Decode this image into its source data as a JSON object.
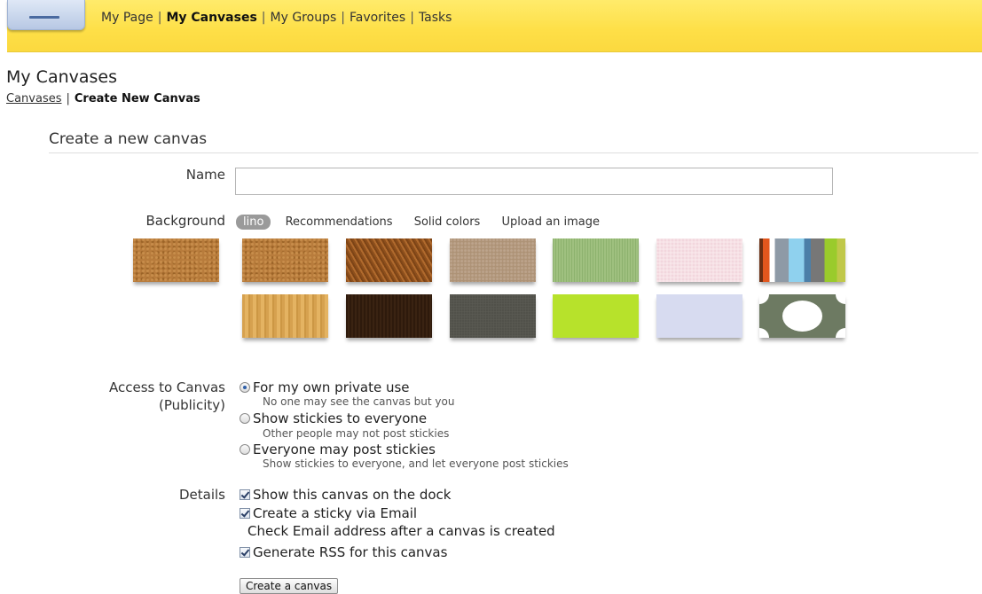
{
  "nav": {
    "items": [
      {
        "label": "My Page"
      },
      {
        "label": "My Canvases"
      },
      {
        "label": "My Groups"
      },
      {
        "label": "Favorites"
      },
      {
        "label": "Tasks"
      }
    ],
    "separator": "|"
  },
  "page": {
    "title": "My Canvases",
    "breadcrumb": {
      "link": "Canvases",
      "separator": "|",
      "current": "Create New Canvas"
    }
  },
  "form": {
    "section_title": "Create a new canvas",
    "name_label": "Name",
    "name_value": "",
    "background_label": "Background",
    "background_tabs": [
      {
        "label": "lino",
        "active": true
      },
      {
        "label": "Recommendations"
      },
      {
        "label": "Solid colors"
      },
      {
        "label": "Upload an image"
      }
    ],
    "access_label_line1": "Access to Canvas",
    "access_label_line2": "(Publicity)",
    "access_options": [
      {
        "label": "For my own private use",
        "description": "No one may see the canvas but you",
        "selected": true
      },
      {
        "label": "Show stickies to everyone",
        "description": "Other people may not post stickies",
        "selected": false
      },
      {
        "label": "Everyone may post stickies",
        "description": "Show stickies to everyone, and let everyone post stickies",
        "selected": false
      }
    ],
    "details_label": "Details",
    "details_options": [
      {
        "label": "Show this canvas on the dock",
        "checked": true
      },
      {
        "label": "Create a sticky via Email",
        "checked": true
      },
      {
        "label": "Generate RSS for this canvas",
        "checked": true
      }
    ],
    "email_note": "Check Email address after a canvas is created",
    "submit_label": "Create a canvas"
  },
  "colors": {
    "topbar": "#fedf47",
    "selected_tab": "#9a9a9a"
  }
}
